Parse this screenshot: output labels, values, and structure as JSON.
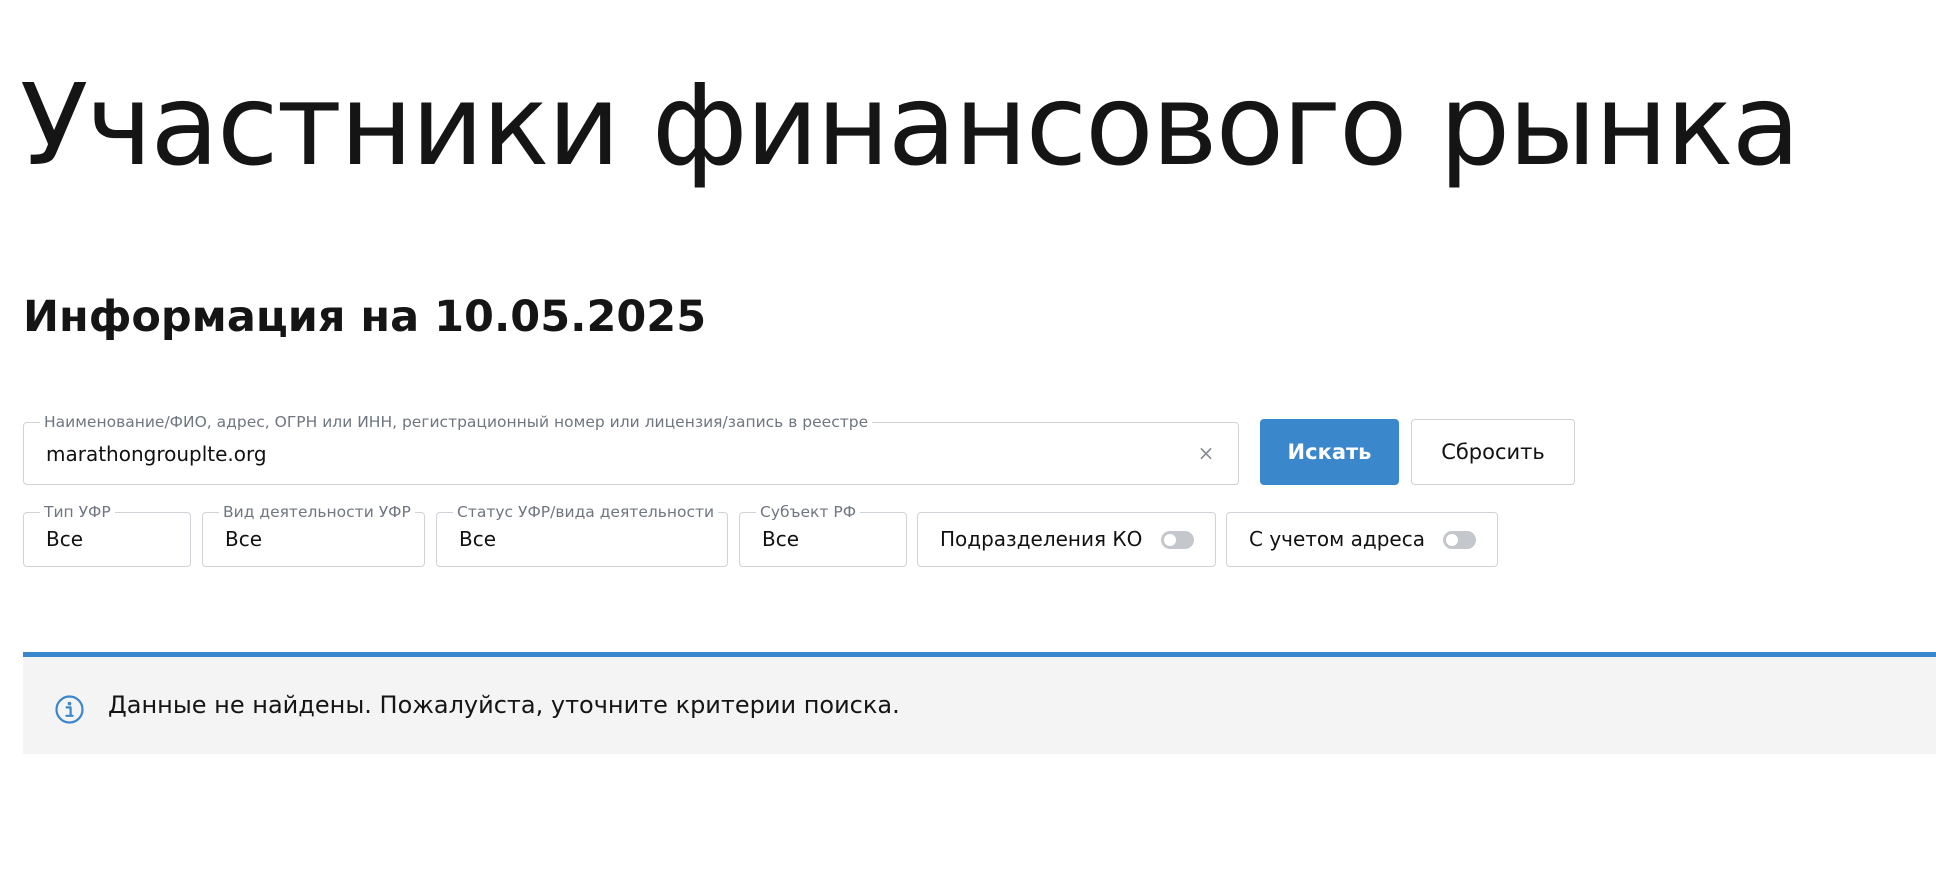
{
  "page": {
    "title": "Участники финансового рынка",
    "info_date": "Информация на 10.05.2025"
  },
  "search": {
    "label": "Наименование/ФИО, адрес, ОГРН или ИНН, регистрационный номер или лицензия/запись в реестре",
    "value": "marathongrouplte.org",
    "clear_glyph": "×",
    "submit_label": "Искать",
    "reset_label": "Сбросить"
  },
  "filters": {
    "type": {
      "label": "Тип УФР",
      "value": "Все"
    },
    "activity": {
      "label": "Вид деятельности УФР",
      "value": "Все"
    },
    "status": {
      "label": "Статус УФР/вида деятельности",
      "value": "Все"
    },
    "region": {
      "label": "Субъект РФ",
      "value": "Все"
    }
  },
  "toggles": {
    "ko_branches": {
      "label": "Подразделения КО",
      "on": false
    },
    "with_address": {
      "label": "С учетом адреса",
      "on": false
    }
  },
  "alert": {
    "icon": "info-icon",
    "message": "Данные не найдены. Пожалуйста, уточните критерии поиска."
  },
  "colors": {
    "accent": "#3a87cb",
    "alert_bg": "#f4f4f4",
    "border": "#cfd3d8",
    "label": "#6f7680",
    "toggle_off": "#c4c7cc"
  }
}
